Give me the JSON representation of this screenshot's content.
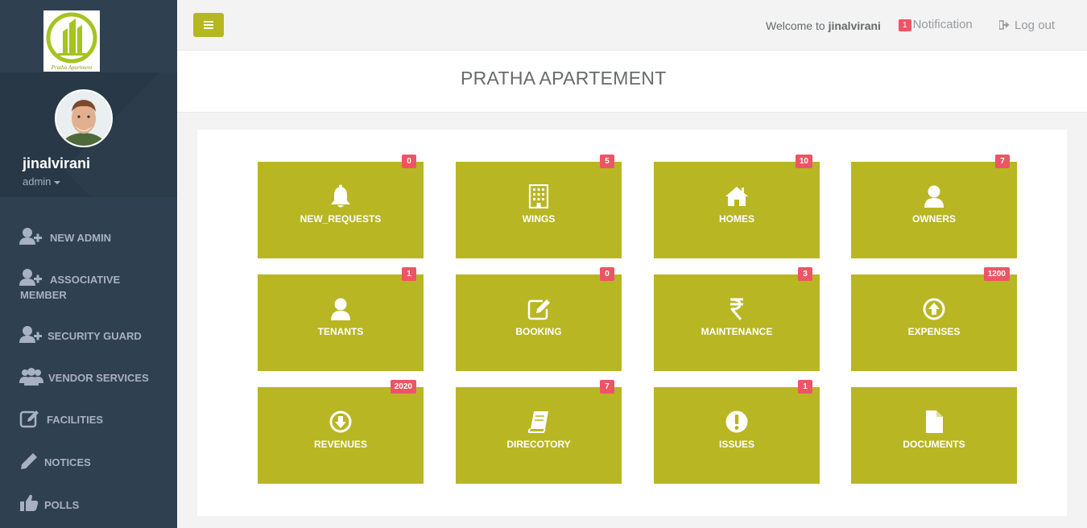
{
  "logo": {
    "caption": "Pratha Apartment"
  },
  "profile": {
    "username": "jinalvirani",
    "role": "admin"
  },
  "sidebar": {
    "items": [
      {
        "label": "NEW ADMIN",
        "icon": "user-plus-icon"
      },
      {
        "label": "ASSOCIATIVE MEMBER",
        "icon": "user-plus-icon"
      },
      {
        "label": "SECURITY GUARD",
        "icon": "user-plus-icon"
      },
      {
        "label": "VENDOR SERVICES",
        "icon": "users-icon"
      },
      {
        "label": "FACILITIES",
        "icon": "edit-icon"
      },
      {
        "label": "NOTICES",
        "icon": "pencil-icon"
      },
      {
        "label": "POLLS",
        "icon": "thumbs-up-icon"
      }
    ]
  },
  "topbar": {
    "welcome_prefix": "Welcome to",
    "welcome_user": "jinalvirani",
    "notification_count": "1",
    "notification_label": "Notification",
    "logout_label": "Log out"
  },
  "page": {
    "title": "PRATHA APARTEMENT"
  },
  "tiles": [
    {
      "label": "NEW_REQUESTS",
      "badge": "0",
      "icon": "bell-icon"
    },
    {
      "label": "WINGS",
      "badge": "5",
      "icon": "building-icon"
    },
    {
      "label": "HOMES",
      "badge": "10",
      "icon": "home-icon"
    },
    {
      "label": "OWNERS",
      "badge": "7",
      "icon": "user-icon"
    },
    {
      "label": "TENANTS",
      "badge": "1",
      "icon": "user-icon"
    },
    {
      "label": "BOOKING",
      "badge": "0",
      "icon": "edit-icon"
    },
    {
      "label": "MAINTENANCE",
      "badge": "3",
      "icon": "rupee-icon"
    },
    {
      "label": "EXPENSES",
      "badge": "1200",
      "icon": "arrow-up-circle-icon"
    },
    {
      "label": "REVENUES",
      "badge": "2020",
      "icon": "arrow-down-circle-icon"
    },
    {
      "label": "DIRECOTORY",
      "badge": "7",
      "icon": "book-icon"
    },
    {
      "label": "ISSUES",
      "badge": "1",
      "icon": "exclamation-circle-icon"
    },
    {
      "label": "DOCUMENTS",
      "badge": "",
      "icon": "file-icon"
    }
  ],
  "colors": {
    "sidebar": "#2f4050",
    "tile": "#b8b623",
    "badge": "#ed5565",
    "accent": "#b5b720"
  }
}
